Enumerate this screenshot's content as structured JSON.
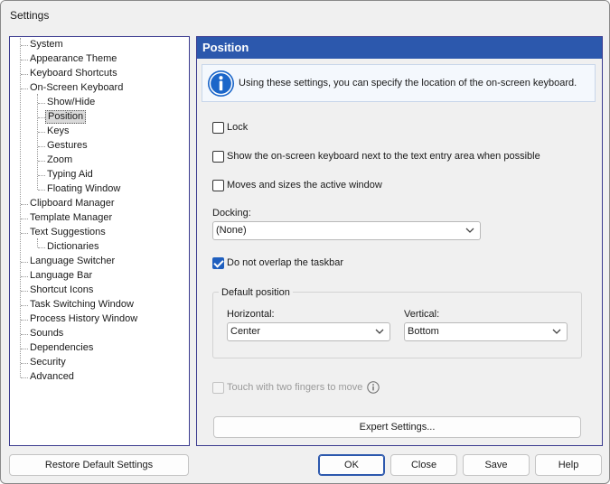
{
  "window": {
    "title": "Settings"
  },
  "tree": {
    "items": [
      {
        "label": "System",
        "level": 0
      },
      {
        "label": "Appearance Theme",
        "level": 0
      },
      {
        "label": "Keyboard Shortcuts",
        "level": 0
      },
      {
        "label": "On-Screen Keyboard",
        "level": 0
      },
      {
        "label": "Show/Hide",
        "level": 1
      },
      {
        "label": "Position",
        "level": 1,
        "selected": true
      },
      {
        "label": "Keys",
        "level": 1
      },
      {
        "label": "Gestures",
        "level": 1
      },
      {
        "label": "Zoom",
        "level": 1
      },
      {
        "label": "Typing Aid",
        "level": 1
      },
      {
        "label": "Floating Window",
        "level": 1
      },
      {
        "label": "Clipboard Manager",
        "level": 0
      },
      {
        "label": "Template Manager",
        "level": 0
      },
      {
        "label": "Text Suggestions",
        "level": 0
      },
      {
        "label": "Dictionaries",
        "level": 1
      },
      {
        "label": "Language Switcher",
        "level": 0
      },
      {
        "label": "Language Bar",
        "level": 0
      },
      {
        "label": "Shortcut Icons",
        "level": 0
      },
      {
        "label": "Task Switching Window",
        "level": 0
      },
      {
        "label": "Process History Window",
        "level": 0
      },
      {
        "label": "Sounds",
        "level": 0
      },
      {
        "label": "Dependencies",
        "level": 0
      },
      {
        "label": "Security",
        "level": 0
      },
      {
        "label": "Advanced",
        "level": 0
      }
    ]
  },
  "panel": {
    "title": "Position",
    "info": "Using these settings, you can specify the location of the on-screen keyboard.",
    "info_icon": "info-icon",
    "lock_label": "Lock",
    "lock_checked": false,
    "show_next_label": "Show the on-screen keyboard next to the text entry area when possible",
    "show_next_checked": false,
    "moves_label": "Moves and sizes the active window",
    "moves_checked": false,
    "docking_label": "Docking:",
    "docking_value": "(None)",
    "overlap_label": "Do not overlap the taskbar",
    "overlap_checked": true,
    "default_position_label": "Default position",
    "horizontal_label": "Horizontal:",
    "horizontal_value": "Center",
    "vertical_label": "Vertical:",
    "vertical_value": "Bottom",
    "touch_label": "Touch with two fingers to move",
    "touch_checked": false,
    "touch_help_icon": "help-icon",
    "expert_button": "Expert Settings..."
  },
  "footer": {
    "restore": "Restore Default Settings",
    "ok": "OK",
    "close": "Close",
    "save": "Save",
    "help": "Help"
  },
  "colors": {
    "accent": "#2c58ad",
    "checkbox_checked": "#1f5fbf",
    "info_icon": "#1b66c9"
  }
}
